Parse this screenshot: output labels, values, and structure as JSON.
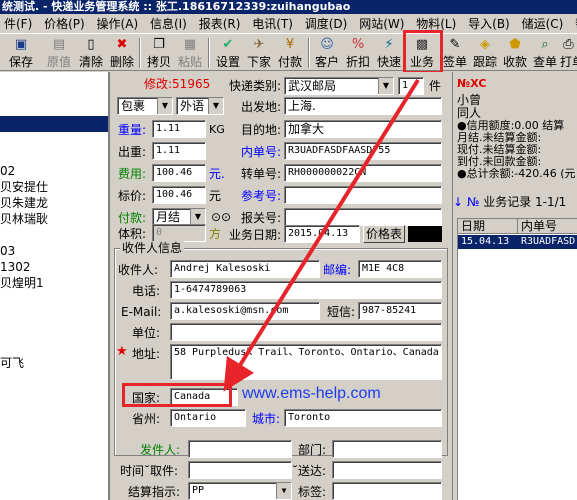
{
  "window": {
    "title": "统测试. - 快递业务管理系统 :: 张工.18616712339:zuihangubao"
  },
  "menu": [
    "件(F)",
    "价格(P)",
    "操作(A)",
    "信息(I)",
    "报表(R)",
    "电讯(T)",
    "调度(D)",
    "网站(W)",
    "物料(L)",
    "导入(B)",
    "储运(C)",
    "帮"
  ],
  "toolbar": [
    {
      "label": "保存",
      "icon": "save-icon"
    },
    {
      "label": "原值",
      "icon": "restore-icon",
      "disabled": true
    },
    {
      "label": "清除",
      "icon": "clear-icon"
    },
    {
      "label": "删除",
      "icon": "delete-icon"
    },
    {
      "label": "拷贝",
      "icon": "copy-icon"
    },
    {
      "label": "粘贴",
      "icon": "paste-icon",
      "disabled": true
    },
    {
      "label": "设置",
      "icon": "settings-icon"
    },
    {
      "label": "下家",
      "icon": "next-party-icon"
    },
    {
      "label": "付款",
      "icon": "payment-icon"
    },
    {
      "label": "客户",
      "icon": "customer-icon"
    },
    {
      "label": "折扣",
      "icon": "discount-icon"
    },
    {
      "label": "快速",
      "icon": "quick-icon"
    },
    {
      "label": "业务",
      "icon": "business-icon"
    },
    {
      "label": "签单",
      "icon": "sign-icon"
    },
    {
      "label": "跟踪",
      "icon": "track-icon"
    },
    {
      "label": "收款",
      "icon": "receive-icon"
    },
    {
      "label": "查单",
      "icon": "search-order-icon"
    },
    {
      "label": "打单",
      "icon": "print-icon"
    }
  ],
  "left_list": [
    "02",
    "贝安提仕",
    "贝朱建龙",
    "贝林瑞耿",
    "03",
    "1302",
    "贝煌明1",
    "可飞"
  ],
  "form": {
    "modify_label": "修改:51965",
    "express_type_label": "快递类别:",
    "express_type_value": "武汉邮局",
    "piece_count": "1",
    "piece_unit": "件",
    "package_type": "包裹",
    "language": "外语",
    "origin_label": "出发地:",
    "origin_value": "上海.",
    "weight_label": "重量:",
    "weight_value": "1.11",
    "weight_unit": "KG",
    "destination_label": "目的地:",
    "destination_value": "加拿大",
    "out_weight_label": "出重:",
    "out_weight_value": "1.11",
    "internal_no_label": "内单号:",
    "internal_no_value": "R3UADFASDFAASDF55",
    "fee_label": "费用:",
    "fee_value": "100.46",
    "fee_unit": "元.",
    "transfer_no_label": "转单号:",
    "transfer_no_value": "RH000000022CN",
    "list_price_label": "标价:",
    "list_price_value": "100.46",
    "list_price_unit": "元",
    "ref_no_label": "参考号:",
    "ref_no_value": "",
    "payment_label": "付款:",
    "payment_value": "月结",
    "customs_no_label": "报关号:",
    "customs_no_value": "",
    "volume_label": "体积:",
    "volume_value": "0",
    "volume_unit": "方",
    "business_date_label": "业务日期:",
    "business_date_value": "2015.04.13",
    "price_table_button": "价格表"
  },
  "recipient": {
    "group_title": "收件人信息",
    "name_label": "收件人:",
    "name_value": "Andrej Kalesoski",
    "postcode_label": "邮编:",
    "postcode_value": "M1E 4C8",
    "phone_label": "电话:",
    "phone_value": "1-6474789063",
    "email_label": "E-Mail:",
    "email_value": "a.kalesoski@msn.com",
    "sms_label": "短信:",
    "sms_value": "987-85241",
    "company_label": "单位:",
    "company_value": "",
    "address_label": "地址:",
    "address_value": "58 Purpledusk Trail、Toronto、Ontario、Canada",
    "country_label": "国家:",
    "country_value": "Canada",
    "province_label": "省州:",
    "province_value": "Ontario",
    "city_label": "城市:",
    "city_value": "Toronto"
  },
  "sender": {
    "sender_label": "发件人:",
    "sender_value": "",
    "dept_label": "部门:",
    "dept_value": "",
    "pickup_time_label": "时间˘取件:",
    "pickup_time_value": "",
    "delivery_label": "˘送达:",
    "delivery_value": "",
    "settlement_label": "结算指示:",
    "settlement_value": "PP",
    "tag_label": "标签:",
    "tag_value": ""
  },
  "watermark": "www.ems-help.com",
  "right": {
    "no_label": "№XC",
    "name": "小曾",
    "same_person": "同人",
    "credit_line": "●信用额度:0.00 结算",
    "monthly_line": "月结.未结算金额:",
    "cash_line": "现付.未结算金额:",
    "cod_line": "到付.未回款金额:",
    "total_line": "●总计余额:-420.46 (元",
    "records_label": "业务记录 1-1/1",
    "grid_headers": [
      "日期",
      "内单号"
    ],
    "grid_rows": [
      [
        "15.04.13",
        "R3UADFASD"
      ]
    ]
  },
  "colors": {
    "highlight": "#e8242b",
    "watermark": "#1d3bf0",
    "title_bar": "#0a246a"
  }
}
